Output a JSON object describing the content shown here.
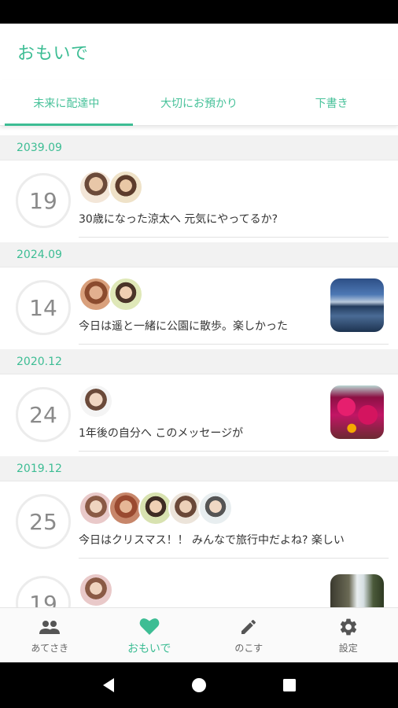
{
  "app": {
    "title": "おもいで"
  },
  "tabs": [
    {
      "label": "未来に配達中"
    },
    {
      "label": "大切にお預かり"
    },
    {
      "label": "下書き"
    }
  ],
  "sections": [
    {
      "date": "2039.09",
      "entries": [
        {
          "day": "19",
          "message": "30歳になった涼太へ 元気にやってるか?"
        }
      ]
    },
    {
      "date": "2024.09",
      "entries": [
        {
          "day": "14",
          "message": "今日は遥と一緒に公園に散歩。楽しかった"
        }
      ]
    },
    {
      "date": "2020.12",
      "entries": [
        {
          "day": "24",
          "message": "1年後の自分へ このメッセージが"
        }
      ]
    },
    {
      "date": "2019.12",
      "entries": [
        {
          "day": "25",
          "message": "今日はクリスマス！！ みんなで旅行中だよね? 楽しい"
        },
        {
          "day": "19",
          "message": ""
        }
      ]
    }
  ],
  "bottom_nav": [
    {
      "label": "あてさき",
      "icon": "people-icon"
    },
    {
      "label": "おもいで",
      "icon": "heart-icon"
    },
    {
      "label": "のこす",
      "icon": "pencil-icon"
    },
    {
      "label": "設定",
      "icon": "gear-icon"
    }
  ],
  "colors": {
    "accent": "#3dbd94",
    "section_bg": "#f2f2f2"
  }
}
